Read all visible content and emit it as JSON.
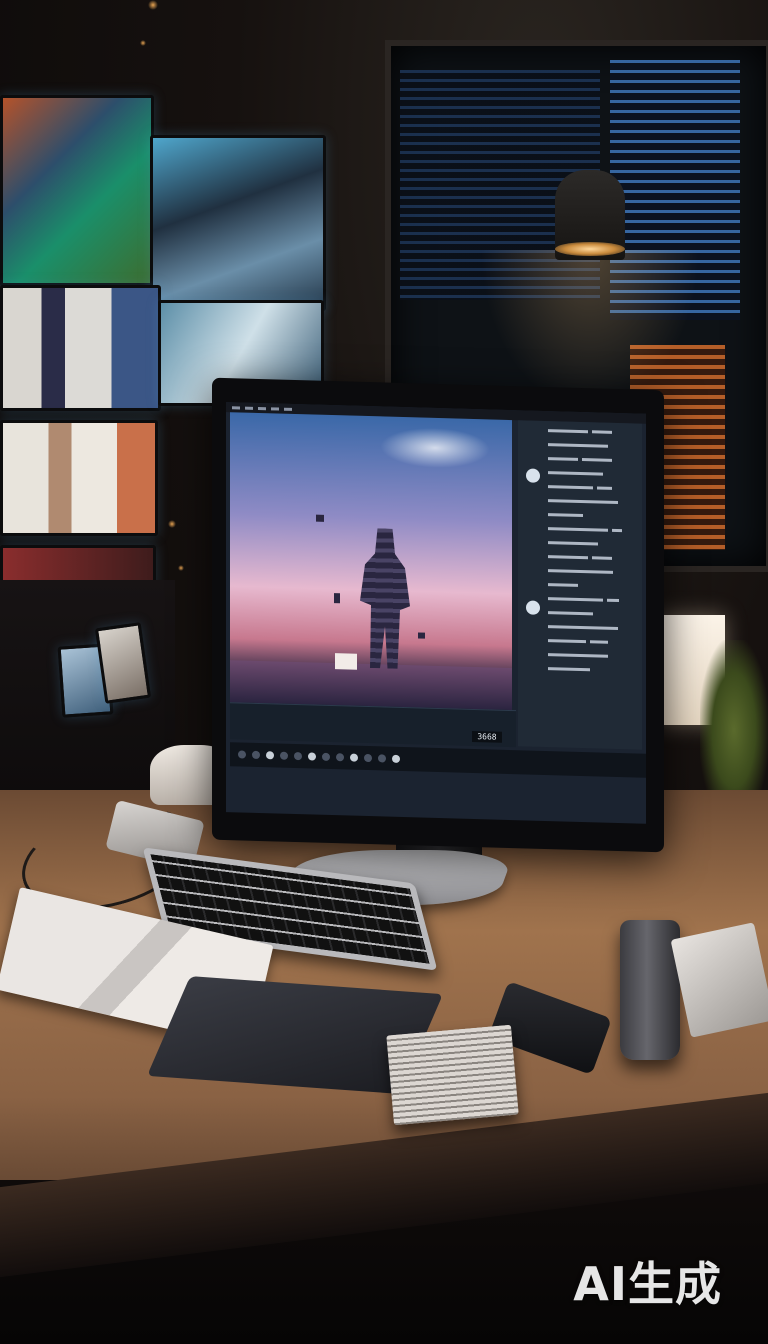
{
  "watermark": {
    "text": "AI生成"
  },
  "monitor_display": {
    "timecode": "3668"
  },
  "colors": {
    "sky_top": "#3a68a8",
    "sky_glow": "#e7b9cf",
    "desk_wood": "#a0734d",
    "ambient_orange": "#c7662a"
  }
}
